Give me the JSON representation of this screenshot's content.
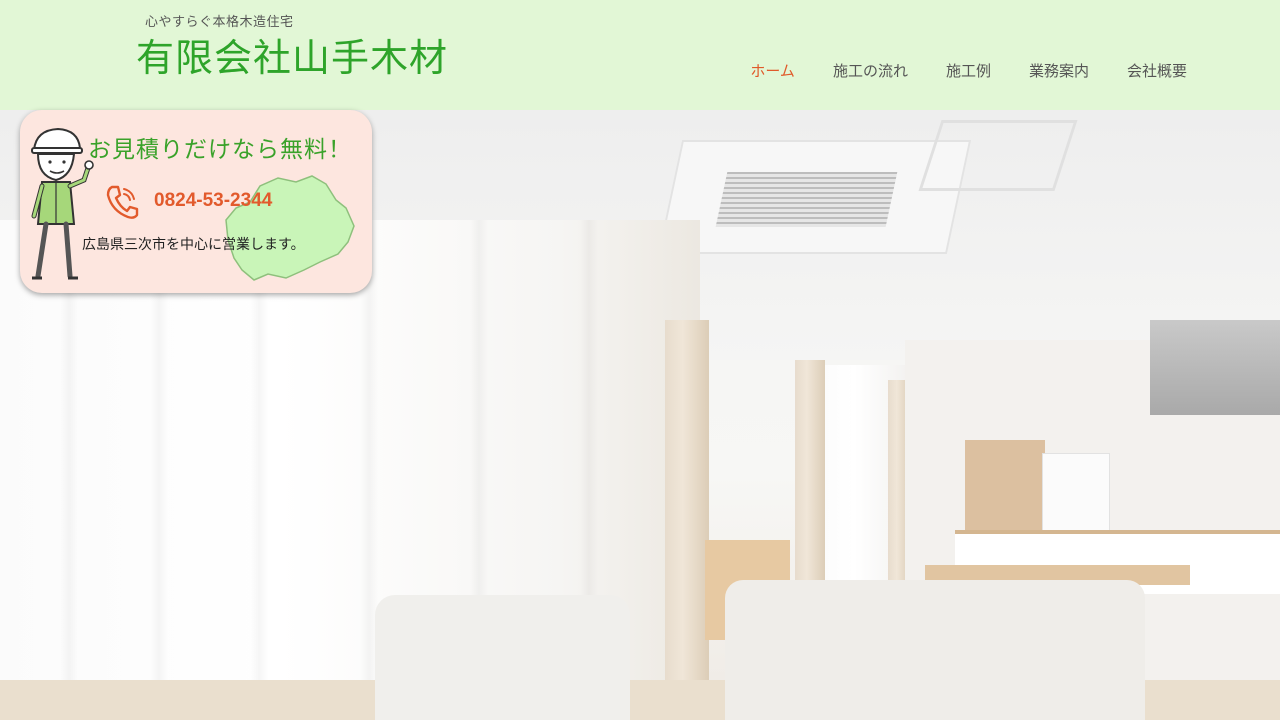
{
  "header": {
    "tagline": "心やすらぐ本格木造住宅",
    "site_title": "有限会社山手木材"
  },
  "nav": {
    "items": [
      {
        "label": "ホーム",
        "active": true
      },
      {
        "label": "施工の流れ",
        "active": false
      },
      {
        "label": "施工例",
        "active": false
      },
      {
        "label": "業務案内",
        "active": false
      },
      {
        "label": "会社概要",
        "active": false
      }
    ]
  },
  "card": {
    "heading": "お見積りだけなら無料！",
    "phone": "0824-53-2344",
    "area": "広島県三次市を中心に営業します。",
    "icons": [
      "worker-illustration-icon",
      "phone-icon",
      "prefecture-map-icon"
    ]
  },
  "hero": {
    "image": "living-room-photo"
  },
  "colors": {
    "header_bg": "#e2f7d6",
    "title_green": "#2ea42a",
    "nav_active": "#e05a2a",
    "card_bg": "#fde6df",
    "phone_orange": "#e25a2c"
  }
}
